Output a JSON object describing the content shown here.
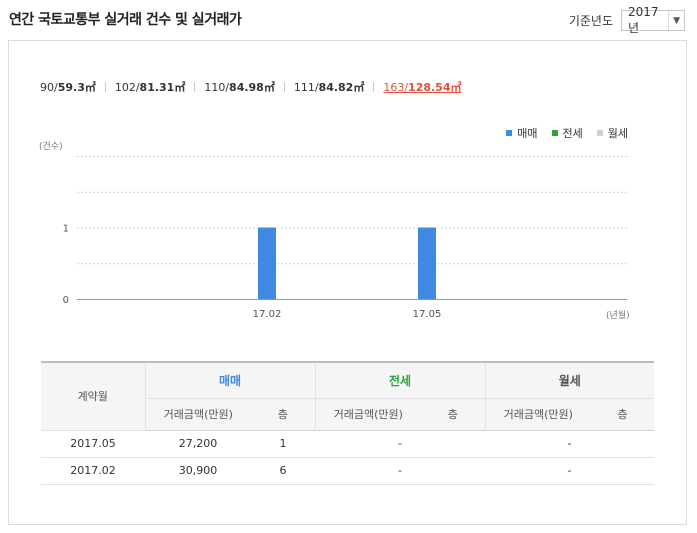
{
  "header": {
    "title": "연간 국토교통부 실거래 건수 및 실거래가",
    "year_label": "기준년도",
    "year_value": "2017년"
  },
  "areas": [
    {
      "supply": "90/",
      "exclusive": "59.3㎡",
      "selected": false
    },
    {
      "supply": "102/",
      "exclusive": "81.31㎡",
      "selected": false
    },
    {
      "supply": "110/",
      "exclusive": "84.98㎡",
      "selected": false
    },
    {
      "supply": "111/",
      "exclusive": "84.82㎡",
      "selected": false
    },
    {
      "supply": "163/",
      "exclusive": "128.54㎡",
      "selected": true
    }
  ],
  "legend": [
    {
      "label": "매매",
      "color": "#4189e0"
    },
    {
      "label": "전세",
      "color": "#2aa53a"
    },
    {
      "label": "월세",
      "color": "#d0d0d0"
    }
  ],
  "chart_data": {
    "type": "bar",
    "ylabel": "(건수)",
    "xlabel": "(년월)",
    "ylim": [
      0,
      2
    ],
    "yticks": [
      0,
      1
    ],
    "grid": true,
    "legend_position": "top-right",
    "categories": [
      "17.02",
      "17.05"
    ],
    "series": [
      {
        "name": "매매",
        "values": [
          1,
          1
        ],
        "color": "#4189e0"
      },
      {
        "name": "전세",
        "values": [
          0,
          0
        ],
        "color": "#2aa53a"
      },
      {
        "name": "월세",
        "values": [
          0,
          0
        ],
        "color": "#d0d0d0"
      }
    ]
  },
  "table": {
    "contract_month_header": "계약월",
    "groups": [
      {
        "label": "매매",
        "price_header": "거래금액(만원)",
        "floor_header": "층"
      },
      {
        "label": "전세",
        "price_header": "거래금액(만원)",
        "floor_header": "층"
      },
      {
        "label": "월세",
        "price_header": "거래금액(만원)",
        "floor_header": "층"
      }
    ],
    "rows": [
      {
        "month": "2017.05",
        "sale_price": "27,200",
        "sale_floor": "1",
        "jeonse": "-",
        "wolse": "-"
      },
      {
        "month": "2017.02",
        "sale_price": "30,900",
        "sale_floor": "6",
        "jeonse": "-",
        "wolse": "-"
      }
    ]
  }
}
